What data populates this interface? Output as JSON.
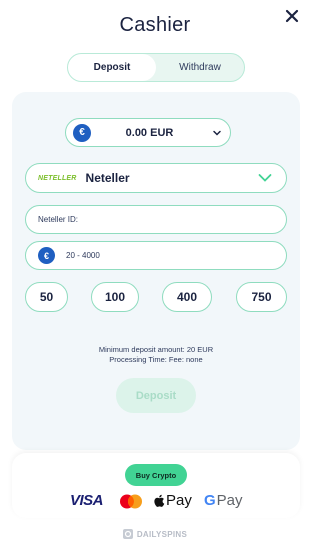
{
  "header": {
    "title": "Cashier"
  },
  "tabs": [
    {
      "label": "Deposit",
      "active": true
    },
    {
      "label": "Withdraw",
      "active": false
    }
  ],
  "currency_selector": {
    "symbol": "€",
    "value": "0.00 EUR"
  },
  "payment_method": {
    "logo_text": "NETELLER",
    "name": "Neteller"
  },
  "neteller_id_field": {
    "placeholder": "Neteller ID:"
  },
  "amount_field": {
    "symbol": "€",
    "placeholder": "20 - 4000"
  },
  "presets": [
    "50",
    "100",
    "400",
    "750"
  ],
  "info": {
    "min_deposit": "Minimum deposit amount: 20 EUR",
    "processing": "Processing Time: Fee: none"
  },
  "deposit_button": {
    "label": "Deposit",
    "enabled": false
  },
  "buy_crypto": {
    "label": "Buy Crypto"
  },
  "payment_logos": {
    "visa": "VISA",
    "apple_pay": "Pay",
    "google_pay_g": "G",
    "google_pay": "Pay"
  },
  "footer": {
    "brand": "DAILYSPINS"
  },
  "colors": {
    "accent_green": "#41d394",
    "border_green": "#8fdcbf",
    "text_dark": "#1b2340",
    "euro_blue": "#1f5fc1",
    "neteller_green": "#7cbf2b"
  }
}
